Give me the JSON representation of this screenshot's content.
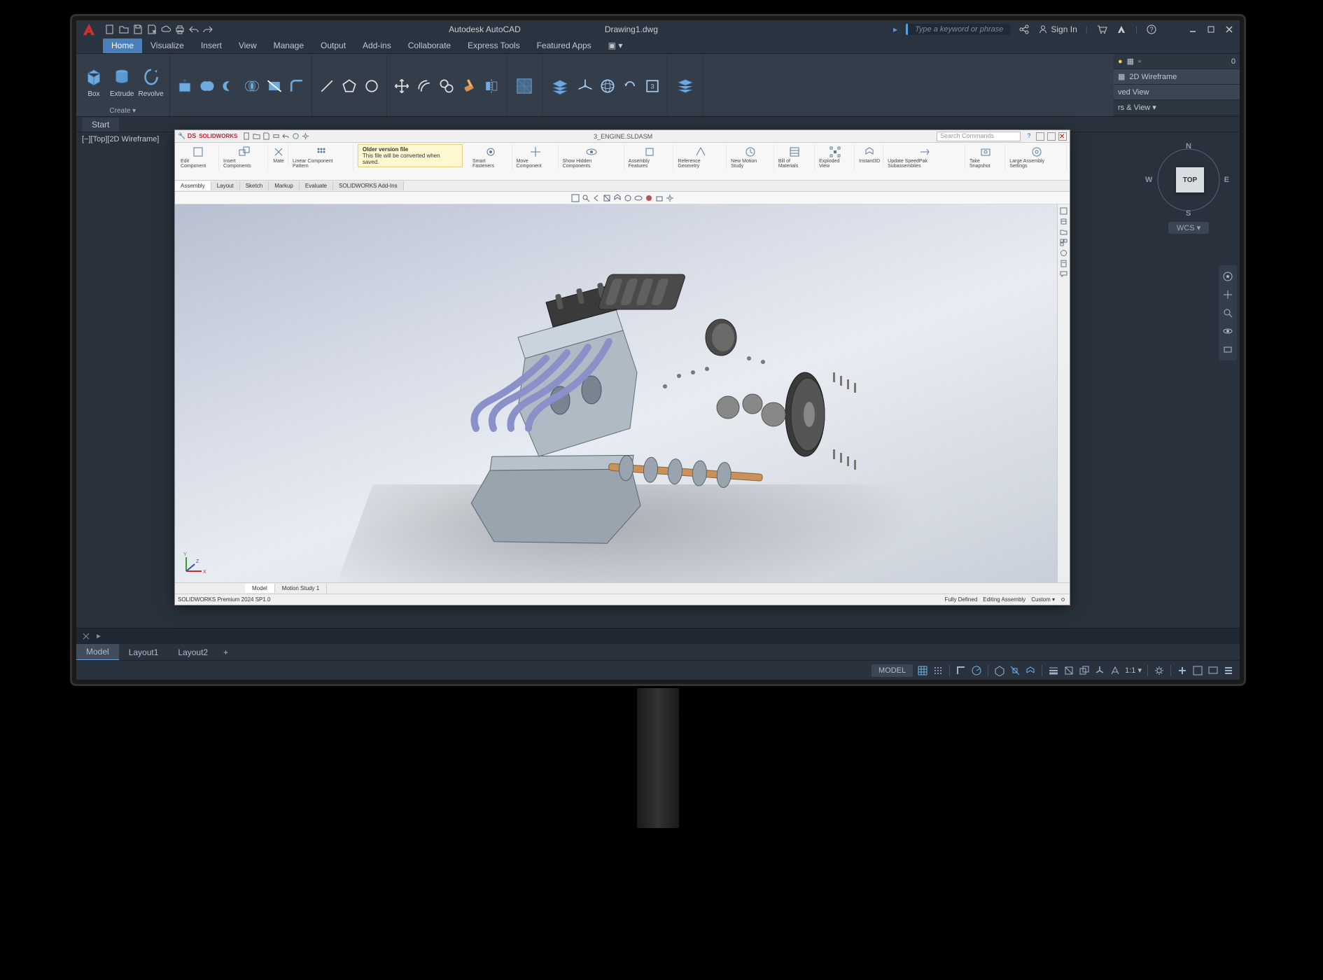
{
  "app": {
    "title": "Autodesk AutoCAD",
    "document": "Drawing1.dwg",
    "search_placeholder": "Type a keyword or phrase",
    "signin": "Sign In"
  },
  "menu_tabs": [
    "Home",
    "Visualize",
    "Insert",
    "View",
    "Manage",
    "Output",
    "Add-ins",
    "Collaborate",
    "Express Tools",
    "Featured Apps"
  ],
  "menu_active": 0,
  "ribbon": {
    "box": "Box",
    "extrude": "Extrude",
    "revolve": "Revolve",
    "create": "Create ▾"
  },
  "right_panel": {
    "value": "0",
    "style": "2D Wireframe",
    "view": "ved View",
    "layers": "rs & View ▾"
  },
  "start_tab": "Start",
  "viewport_label": "[−][Top][2D Wireframe]",
  "viewcube": {
    "face": "TOP",
    "wcs": "WCS ▾",
    "n": "N",
    "s": "S",
    "e": "E",
    "w": "W"
  },
  "bottom_tabs": [
    "Model",
    "Layout1",
    "Layout2"
  ],
  "bottom_active": 0,
  "status": {
    "model": "MODEL",
    "scale": "1:1 ▾"
  },
  "solidworks": {
    "brand": "SOLIDWORKS",
    "doc_title": "3_ENGINE.SLDASM",
    "search_ph": "Search Commands",
    "msg_title": "Older version file",
    "msg_body": "This file will be converted when saved.",
    "ribbon_btns": [
      "Edit Component",
      "Insert Components",
      "Mate",
      "Linear Component Pattern",
      "Smart Fasteners",
      "Move Component",
      "Show Hidden Components",
      "Assembly Features",
      "Reference Geometry",
      "New Motion Study",
      "Bill of Materials",
      "Exploded View",
      "Instant3D",
      "Update SpeedPak Subassemblies",
      "Take Snapshot",
      "Large Assembly Settings"
    ],
    "top_tabs": [
      "Assembly",
      "Layout",
      "Sketch",
      "Markup",
      "Evaluate",
      "SOLIDWORKS Add-Ins"
    ],
    "top_active": 0,
    "bottom_tabs": [
      "Model",
      "Motion Study 1"
    ],
    "bottom_active": 0,
    "status_version": "SOLIDWORKS Premium 2024 SP1.0",
    "status_defined": "Fully Defined",
    "status_mode": "Editing Assembly",
    "status_custom": "Custom ▾"
  }
}
